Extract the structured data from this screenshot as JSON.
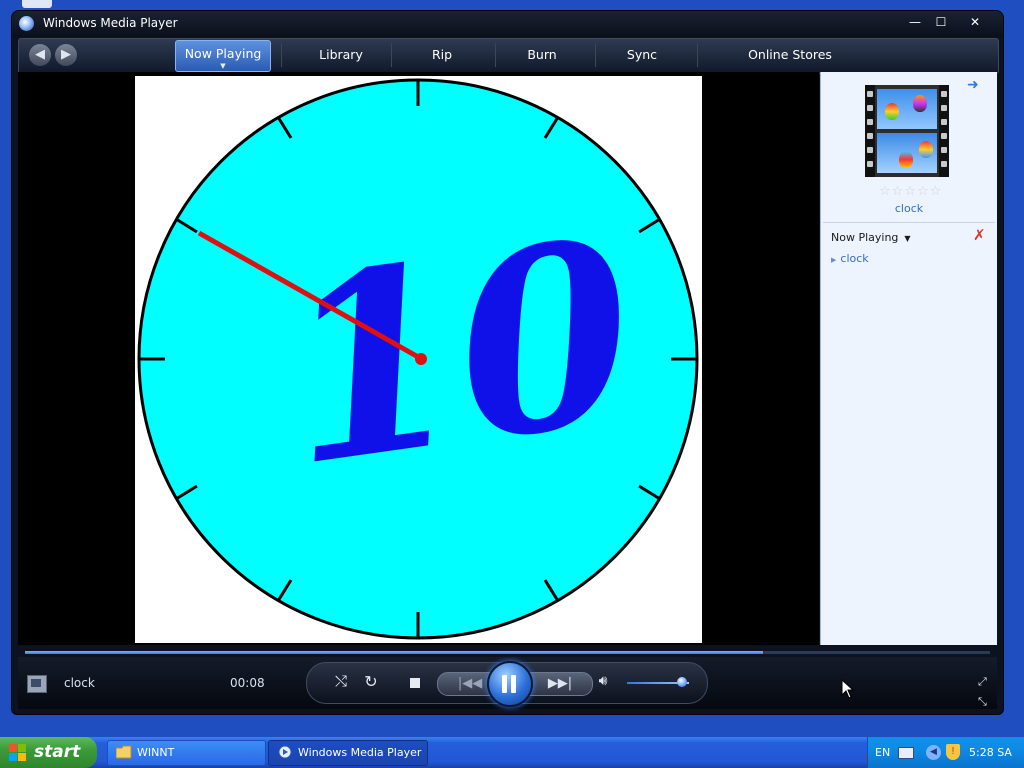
{
  "window": {
    "title": "Windows Media Player",
    "buttons": {
      "minimize": "—",
      "maximize": "☐",
      "close": "✕"
    }
  },
  "nav": {
    "back_icon": "back-arrow-icon",
    "forward_icon": "forward-arrow-icon",
    "tabs": [
      {
        "label": "Now Playing",
        "active": true
      },
      {
        "label": "Library",
        "active": false
      },
      {
        "label": "Rip",
        "active": false
      },
      {
        "label": "Burn",
        "active": false
      },
      {
        "label": "Sync",
        "active": false
      },
      {
        "label": "Online Stores",
        "active": false
      }
    ]
  },
  "video": {
    "clock_number": "10",
    "face_color": "#00ffff",
    "digit_color": "#1010e8",
    "hand_color": "#e01010"
  },
  "side_pane": {
    "media_title": "clock",
    "rating_stars": "☆☆☆☆☆",
    "playlist_label": "Now Playing",
    "playlist_items": [
      "clock"
    ]
  },
  "player": {
    "now_playing": "clock",
    "elapsed": "00:08",
    "seek_progress": 0.765,
    "volume_level": 0.88,
    "accent_color": "#2b6fd8"
  },
  "taskbar": {
    "start_label": "start",
    "tasks": [
      {
        "label": "WINNT",
        "icon": "folder-icon",
        "active": false
      },
      {
        "label": "Windows Media Player",
        "icon": "media-player-icon",
        "active": true
      }
    ],
    "language": "EN",
    "clock": "5:28 SA"
  }
}
